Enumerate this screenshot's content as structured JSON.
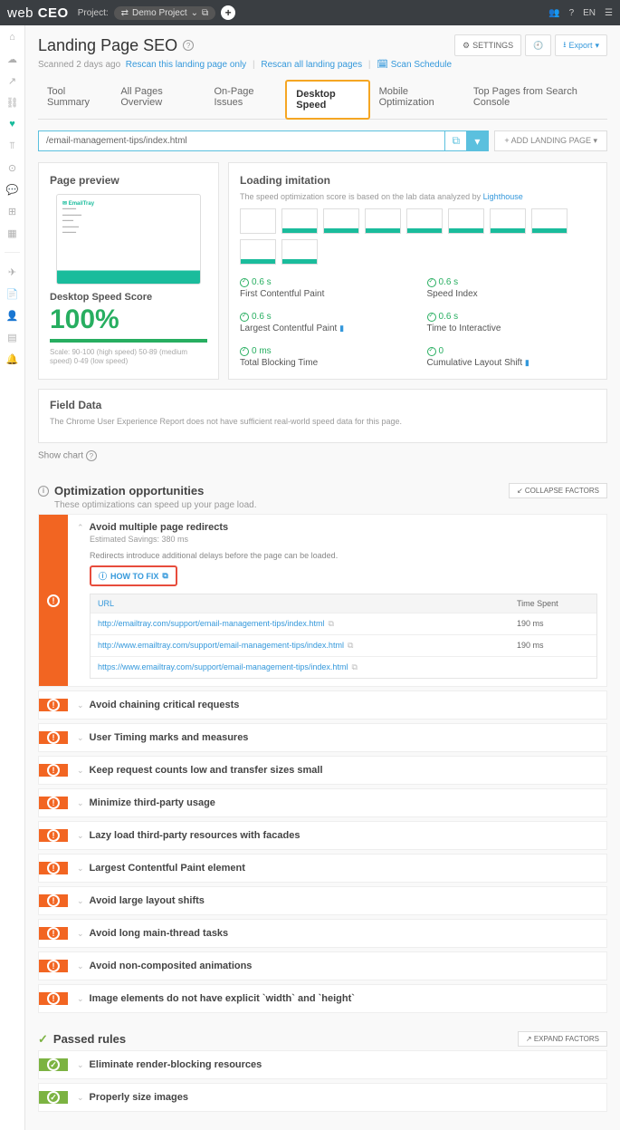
{
  "topbar": {
    "logo1": "web",
    "logo2": "CEO",
    "project_label": "Project:",
    "project_name": "Demo Project",
    "lang": "EN"
  },
  "page": {
    "title": "Landing Page SEO",
    "scanned": "Scanned 2 days ago",
    "rescan_one": "Rescan this landing page only",
    "rescan_all": "Rescan all landing pages",
    "scan_schedule": "Scan Schedule",
    "settings": "SETTINGS",
    "export": "Export"
  },
  "tabs": {
    "t1": "Tool Summary",
    "t2": "All Pages Overview",
    "t3": "On-Page Issues",
    "t4": "Desktop Speed",
    "t5": "Mobile Optimization",
    "t6": "Top Pages from Search Console"
  },
  "url_input": "/email-management-tips/index.html",
  "add_page": "+ ADD LANDING PAGE",
  "preview": {
    "title": "Page preview",
    "score_label": "Desktop Speed Score",
    "score": "100%",
    "scale": "Scale: 90-100 (high speed) 50-89 (medium speed) 0-49 (low speed)"
  },
  "loading": {
    "title": "Loading imitation",
    "sub1": "The speed optimization score is based on the lab data analyzed by ",
    "sub2": "Lighthouse",
    "m1v": "0.6 s",
    "m1l": "First Contentful Paint",
    "m2v": "0.6 s",
    "m2l": "Speed Index",
    "m3v": "0.6 s",
    "m3l": "Largest Contentful Paint",
    "m4v": "0.6 s",
    "m4l": "Time to Interactive",
    "m5v": "0 ms",
    "m5l": "Total Blocking Time",
    "m6v": "0",
    "m6l": "Cumulative Layout Shift"
  },
  "field": {
    "title": "Field Data",
    "text": "The Chrome User Experience Report does not have sufficient real-world speed data for this page."
  },
  "show_chart": "Show chart",
  "opt": {
    "title": "Optimization opportunities",
    "sub": "These optimizations can speed up your page load.",
    "collapse": "COLLAPSE FACTORS"
  },
  "f1": {
    "title": "Avoid multiple page redirects",
    "savings": "Estimated Savings: 380 ms",
    "desc": "Redirects introduce additional delays before the page can be loaded.",
    "howto": "HOW TO FIX",
    "col_url": "URL",
    "col_time": "Time Spent",
    "r1u": "http://emailtray.com/support/email-management-tips/index.html",
    "r1t": "190 ms",
    "r2u": "http://www.emailtray.com/support/email-management-tips/index.html",
    "r2t": "190 ms",
    "r3u": "https://www.emailtray.com/support/email-management-tips/index.html",
    "r3t": ""
  },
  "factors": {
    "f2": "Avoid chaining critical requests",
    "f3": "User Timing marks and measures",
    "f4": "Keep request counts low and transfer sizes small",
    "f5": "Minimize third-party usage",
    "f6": "Lazy load third-party resources with facades",
    "f7": "Largest Contentful Paint element",
    "f8": "Avoid large layout shifts",
    "f9": "Avoid long main-thread tasks",
    "f10": "Avoid non-composited animations",
    "f11": "Image elements do not have explicit `width` and `height`"
  },
  "passed": {
    "title": "Passed rules",
    "expand": "EXPAND FACTORS",
    "p1": "Eliminate render-blocking resources",
    "p2": "Properly size images"
  }
}
